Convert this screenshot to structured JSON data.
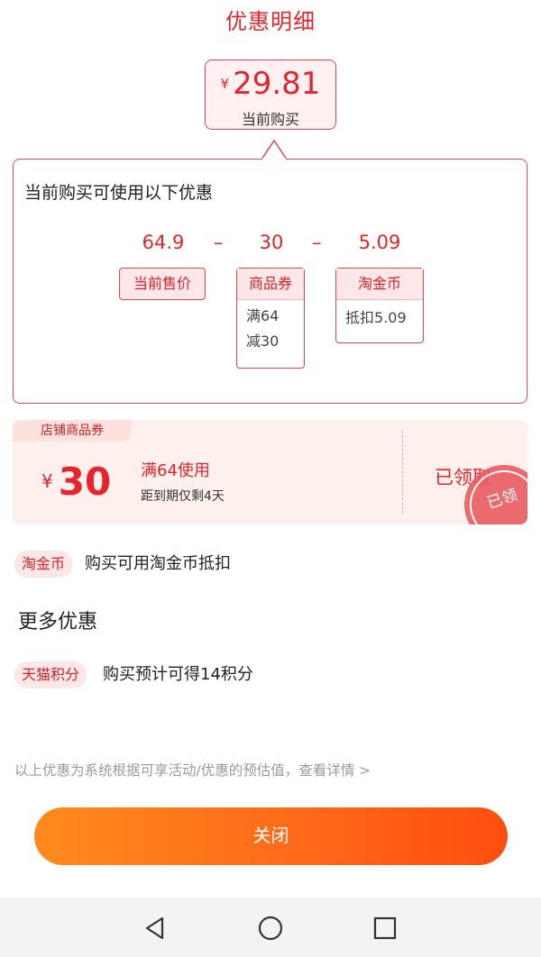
{
  "header": {
    "title": "优惠明细"
  },
  "summary": {
    "currency": "¥",
    "price": "29.81",
    "caption": "当前购买"
  },
  "breakdown": {
    "heading": "当前购买可使用以下优惠",
    "values": [
      "64.9",
      "30",
      "5.09"
    ],
    "operator": "–",
    "items": [
      {
        "label": "当前售价",
        "details": []
      },
      {
        "label": "商品券",
        "details": [
          "满64",
          "减30"
        ]
      },
      {
        "label": "淘金币",
        "details": [
          "抵扣5.09"
        ]
      }
    ]
  },
  "coupon": {
    "tag": "店铺商品券",
    "currency": "¥",
    "amount": "30",
    "condition": "满64使用",
    "expiry": "距到期仅剩4天",
    "status": "已领取",
    "stamp": "已领"
  },
  "taojinbi": {
    "tag": "淘金币",
    "text": "购买可用淘金币抵扣"
  },
  "more": {
    "title": "更多优惠"
  },
  "tmall": {
    "tag": "天猫积分",
    "text": "购买预计可得14积分"
  },
  "footnote": "以上优惠为系统根据可享活动/优惠的预估值，查看详情 >",
  "close_label": "关闭",
  "colors": {
    "accent": "#e5242b",
    "button_start": "#ff8a1d",
    "button_end": "#ff4e10"
  },
  "system_nav": {
    "back": "back-icon",
    "home": "home-icon",
    "recents": "recents-icon"
  }
}
